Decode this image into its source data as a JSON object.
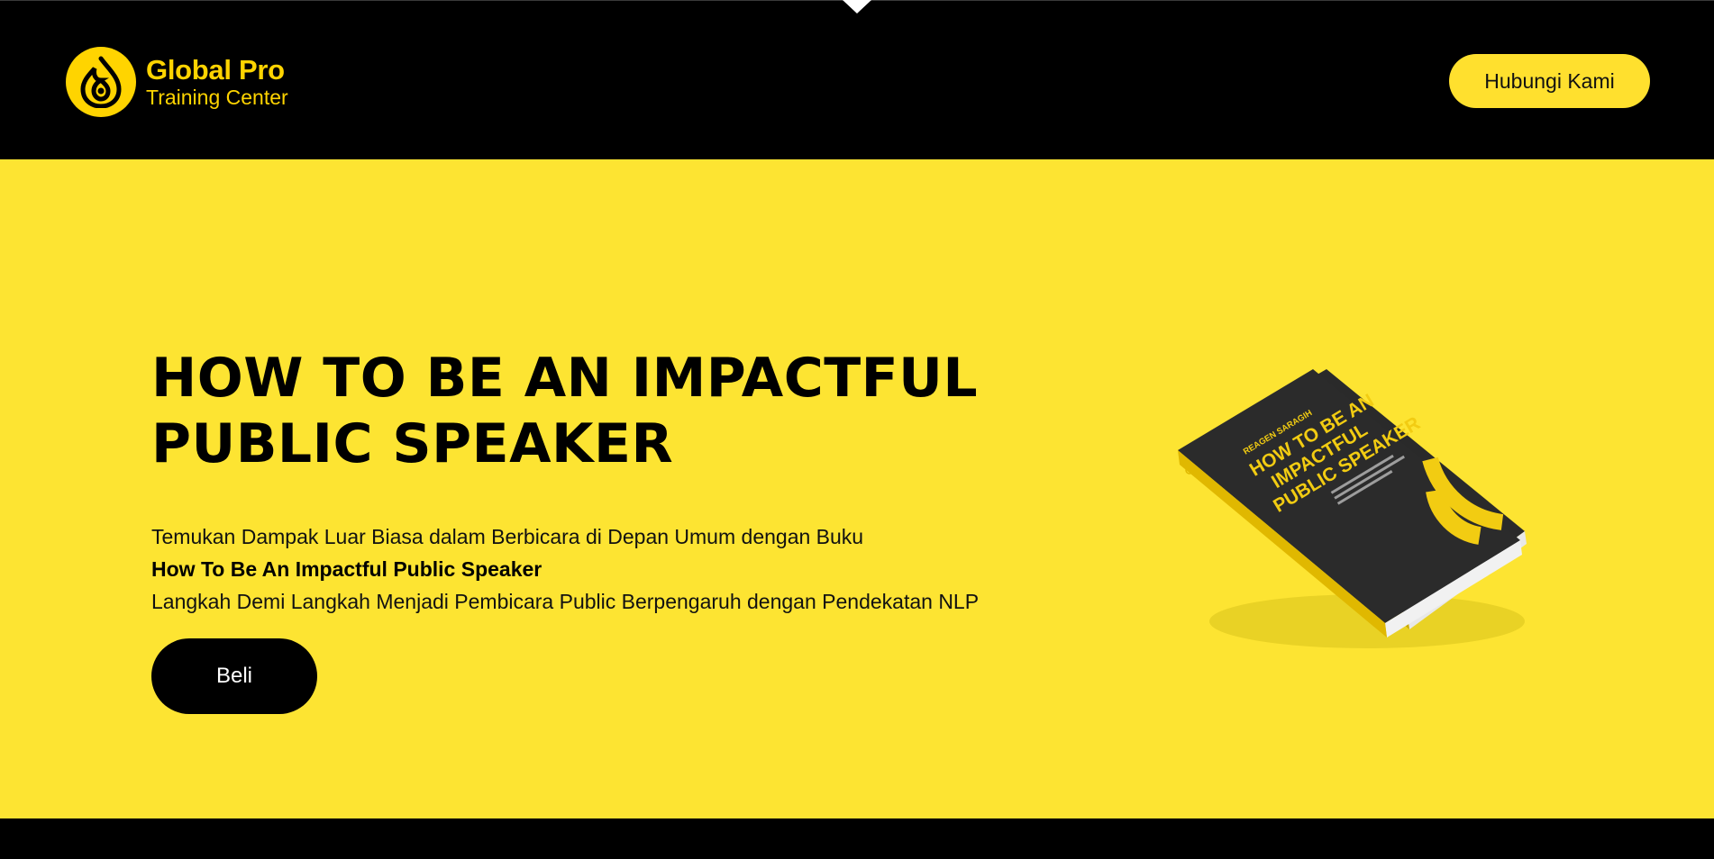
{
  "colors": {
    "brand_yellow": "#fde432",
    "accent_yellow": "#ffd400",
    "dark": "#000000",
    "book_cover": "#2b2b2b"
  },
  "header": {
    "logo": {
      "icon": "flame-drop-logo-icon",
      "title": "Global Pro",
      "subtitle": "Training Center"
    },
    "contact_label": "Hubungi Kami"
  },
  "hero": {
    "title_line1": "HOW TO BE AN IMPACTFUL",
    "title_line2": "PUBLIC SPEAKER",
    "desc_line1": "Temukan Dampak Luar Biasa dalam Berbicara di Depan Umum dengan Buku",
    "desc_line2": "How To Be An Impactful Public Speaker",
    "desc_line3": "Langkah Demi Langkah Menjadi Pembicara Public Berpengaruh dengan Pendekatan NLP",
    "buy_label": "Beli"
  },
  "book": {
    "author": "REAGEN SARAGIH",
    "title_line1": "HOW TO BE AN",
    "title_line2": "IMPACTFUL",
    "title_line3": "PUBLIC SPEAKER"
  }
}
